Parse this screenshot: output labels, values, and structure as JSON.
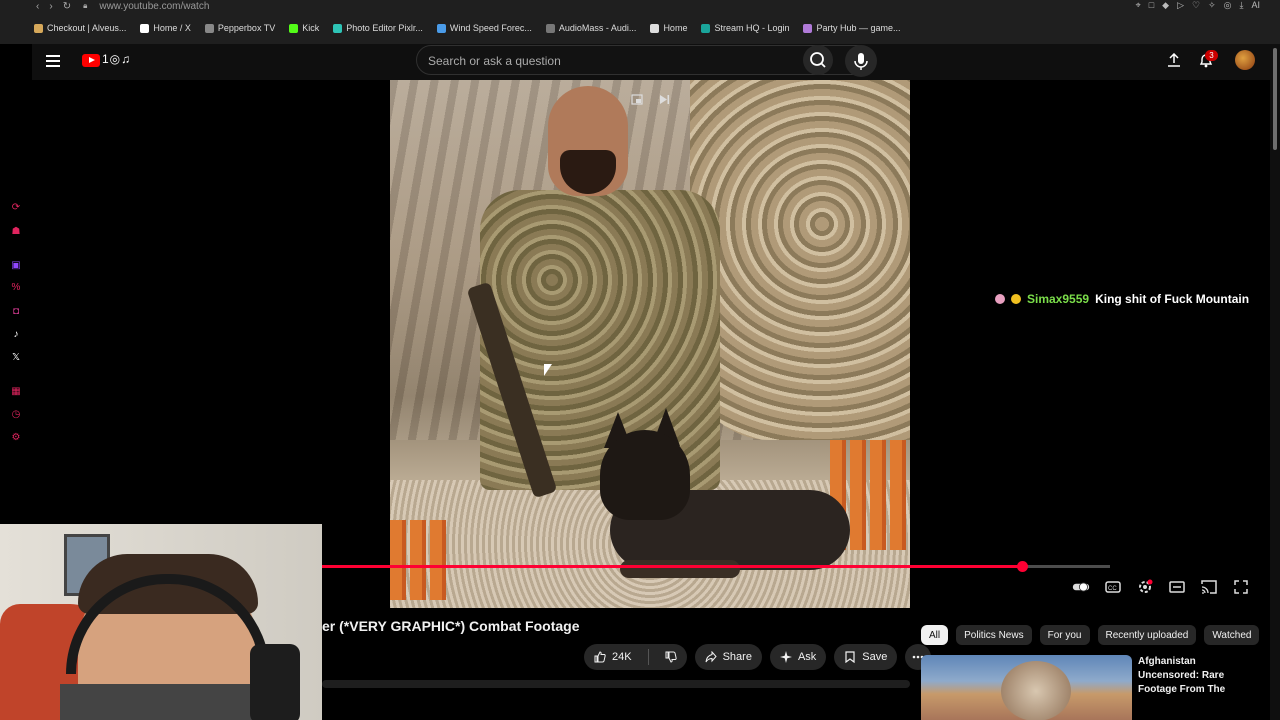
{
  "browser": {
    "url": "www.youtube.com/watch",
    "bookmarks": [
      {
        "label": "Checkout | Alveus...",
        "color": "#d6a85a"
      },
      {
        "label": "Home / X",
        "color": "#ffffff"
      },
      {
        "label": "Pepperbox TV",
        "color": "#888888"
      },
      {
        "label": "Kick",
        "color": "#53fc18"
      },
      {
        "label": "Photo Editor Pixlr...",
        "color": "#2ec4b6"
      },
      {
        "label": "Wind Speed Forec...",
        "color": "#4a9be8"
      },
      {
        "label": "AudioMass - Audi...",
        "color": "#777777"
      },
      {
        "label": "Home",
        "color": "#dddddd"
      },
      {
        "label": "Stream HQ - Login",
        "color": "#1aa59b"
      },
      {
        "label": "Party Hub — game...",
        "color": "#b07ad8"
      }
    ]
  },
  "masthead": {
    "search_placeholder": "Search or ask a question",
    "notification_count": "3"
  },
  "player": {
    "progress_fraction": 0.888,
    "accent_color": "#ff0033"
  },
  "chat_overlay": {
    "username": "Simax9559",
    "message": "King shit of Fuck Mountain"
  },
  "video": {
    "title": "er (*VERY GRAPHIC*) Combat Footage",
    "like_count": "24K",
    "share_label": "Share",
    "ask_label": "Ask",
    "save_label": "Save"
  },
  "right_column": {
    "chips": [
      "All",
      "Politics News",
      "For you",
      "Recently uploaded",
      "Watched"
    ],
    "active_chip": "All",
    "recommendation_title": "Afghanistan Uncensored: Rare Footage From The"
  }
}
